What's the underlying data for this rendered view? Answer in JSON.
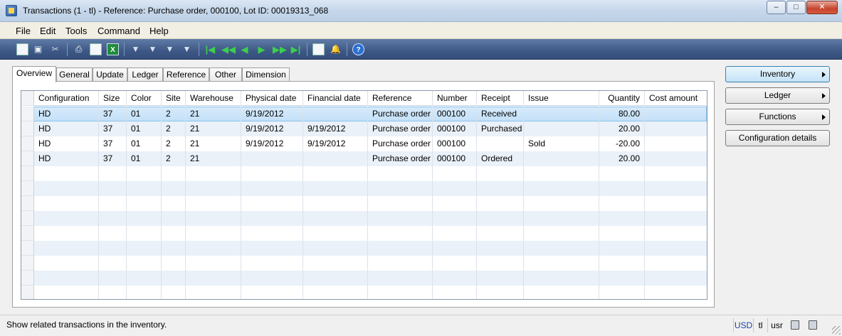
{
  "window": {
    "title": "Transactions (1 - tl) - Reference: Purchase order, 000100, Lot ID: 00019313_068",
    "minimize": "–",
    "maximize": "□",
    "close": "✕"
  },
  "menu": [
    "File",
    "Edit",
    "Tools",
    "Command",
    "Help"
  ],
  "toolbar": {
    "icons": [
      "new-icon",
      "save-icon",
      "delete-icon",
      "print-icon",
      "print-preview-icon",
      "export-excel-icon",
      "filter-by-selection-icon",
      "filter-by-grid-icon",
      "advanced-filter-icon",
      "remove-filter-icon",
      "first-record-icon",
      "previous-page-icon",
      "previous-record-icon",
      "next-record-icon",
      "next-page-icon",
      "last-record-icon",
      "attach-document-icon",
      "alert-icon",
      "help-icon"
    ]
  },
  "tabs": [
    "Overview",
    "General",
    "Update",
    "Ledger",
    "Reference",
    "Other",
    "Dimension"
  ],
  "active_tab": "Overview",
  "grid": {
    "columns": [
      "Configuration",
      "Size",
      "Color",
      "Site",
      "Warehouse",
      "Physical date",
      "Financial date",
      "Reference",
      "Number",
      "Receipt",
      "Issue",
      "Quantity",
      "Cost amount"
    ],
    "rows": [
      [
        "HD",
        "37",
        "01",
        "2",
        "21",
        "9/19/2012",
        "",
        "Purchase order",
        "000100",
        "Received",
        "",
        "80.00",
        ""
      ],
      [
        "HD",
        "37",
        "01",
        "2",
        "21",
        "9/19/2012",
        "9/19/2012",
        "Purchase order",
        "000100",
        "Purchased",
        "",
        "20.00",
        ""
      ],
      [
        "HD",
        "37",
        "01",
        "2",
        "21",
        "9/19/2012",
        "9/19/2012",
        "Purchase order",
        "000100",
        "",
        "Sold",
        "-20.00",
        ""
      ],
      [
        "HD",
        "37",
        "01",
        "2",
        "21",
        "",
        "",
        "Purchase order",
        "000100",
        "Ordered",
        "",
        "20.00",
        ""
      ]
    ],
    "selected_row": 0
  },
  "side_buttons": [
    {
      "label": "Inventory",
      "has_submenu": true
    },
    {
      "label": "Ledger",
      "has_submenu": true
    },
    {
      "label": "Functions",
      "has_submenu": true
    },
    {
      "label": "Configuration details",
      "has_submenu": false
    }
  ],
  "status": {
    "text": "Show related transactions in the inventory.",
    "currency": "USD",
    "company": "tl",
    "layer": "usr"
  },
  "colors": {
    "toolbar_bg": "#3d5886",
    "selected_row": "#c3e0f8",
    "alt_row": "#eaf1f9"
  }
}
